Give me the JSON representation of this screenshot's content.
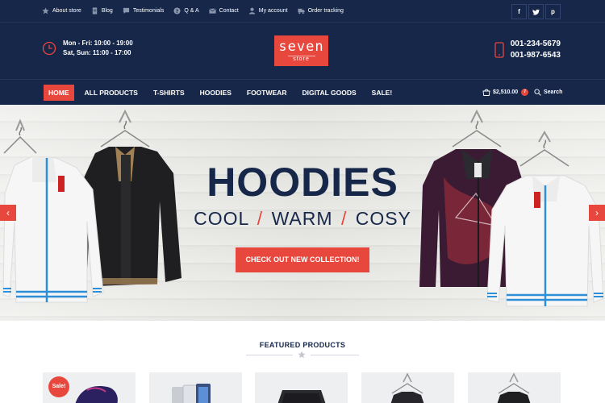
{
  "topbar": {
    "links": [
      {
        "label": "About store",
        "icon": "star-icon"
      },
      {
        "label": "Blog",
        "icon": "document-icon"
      },
      {
        "label": "Testimonials",
        "icon": "chat-icon"
      },
      {
        "label": "Q & A",
        "icon": "question-icon"
      },
      {
        "label": "Contact",
        "icon": "envelope-icon"
      },
      {
        "label": "My account",
        "icon": "user-icon"
      },
      {
        "label": "Order tracking",
        "icon": "truck-icon"
      }
    ],
    "social": [
      "f",
      "t",
      "p"
    ]
  },
  "header": {
    "hours_line1": "Mon - Fri: 10:00 - 19:00",
    "hours_line2": "Sat, Sun: 11:00 - 17:00",
    "logo_main": "seven",
    "logo_sub": "store",
    "phone1": "001-234-5679",
    "phone2": "001-987-6543"
  },
  "nav": {
    "items": [
      "HOME",
      "ALL PRODUCTS",
      "T-SHIRTS",
      "HOODIES",
      "FOOTWEAR",
      "DIGITAL GOODS",
      "SALE!"
    ],
    "active_index": 0,
    "cart_total": "$2,510.00",
    "cart_count": "7",
    "search_label": "Search"
  },
  "hero": {
    "title": "HOODIES",
    "sub1": "COOL",
    "sub2": "WARM",
    "sub3": "COSY",
    "separator": "/",
    "cta": "CHECK OUT NEW COLLECTION!",
    "prev": "‹",
    "next": "›"
  },
  "featured": {
    "title": "FEATURED PRODUCTS",
    "sale_badge": "Sale!"
  },
  "colors": {
    "navy": "#16274a",
    "accent": "#e8473d"
  }
}
